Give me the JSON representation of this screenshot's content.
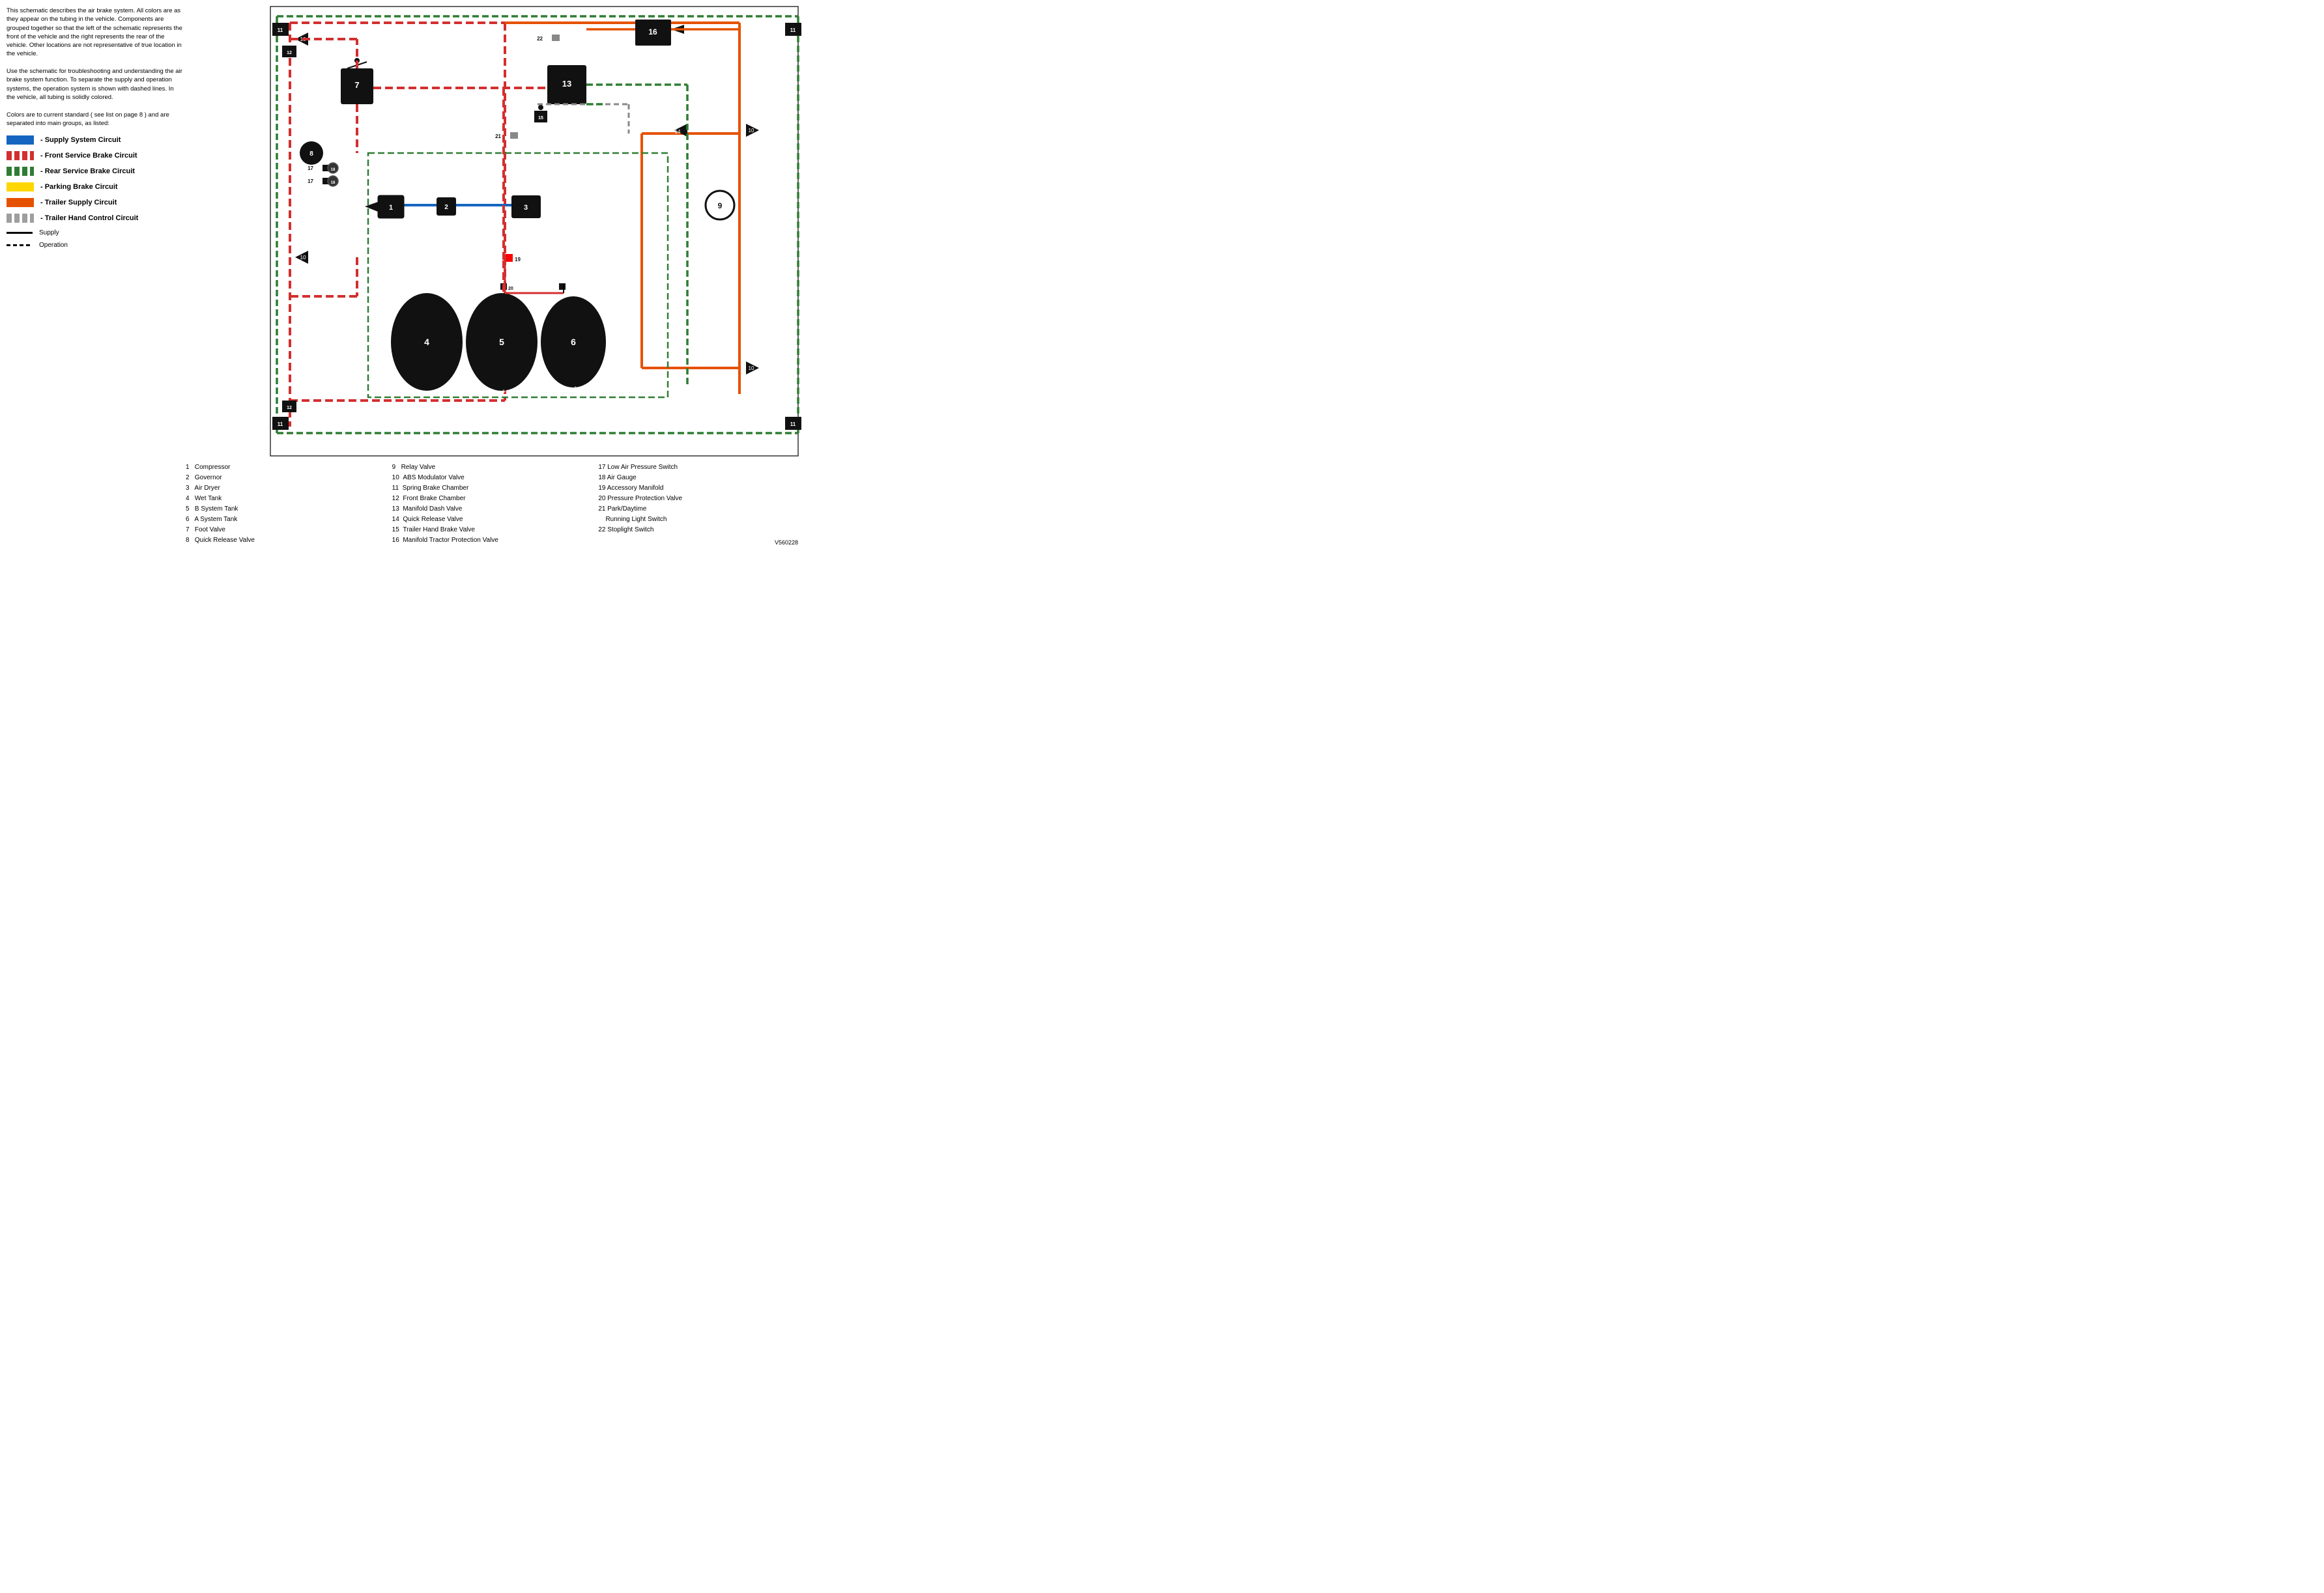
{
  "description": {
    "para1": "This schematic describes the air brake system. All colors are as they appear on the tubing in the vehicle. Components are grouped together so that the left of the schematic represents the front of the vehicle and the right represents the rear of the vehicle. Other locations are not representative of true location in the vehicle.",
    "para2": "Use the schematic for troubleshooting and understanding the air brake system function. To separate the supply and operation systems, the operation system is shown with dashed lines. In the vehicle, all tubing is solidly colored.",
    "para3": "Colors are to current standard ( see list on page 8 ) and are separated into main groups, as listed:"
  },
  "legend": [
    {
      "id": "supply-system",
      "color": "#1565C0",
      "style": "solid",
      "label": "- Supply System Circuit"
    },
    {
      "id": "front-service-brake",
      "color": "#D32F2F",
      "style": "dashed",
      "label": "- Front Service Brake Circuit"
    },
    {
      "id": "rear-service-brake",
      "color": "#2E7D32",
      "style": "dashed",
      "label": "- Rear Service Brake Circuit"
    },
    {
      "id": "parking-brake",
      "color": "#FFD600",
      "style": "solid",
      "label": "- Parking Brake Circuit"
    },
    {
      "id": "trailer-supply",
      "color": "#E65100",
      "style": "solid",
      "label": "- Trailer Supply Circuit"
    },
    {
      "id": "trailer-hand-control",
      "color": "#9E9E9E",
      "style": "dashed",
      "label": "- Trailer Hand Control Circuit"
    }
  ],
  "line_types": [
    {
      "id": "supply",
      "style": "solid",
      "label": "Supply"
    },
    {
      "id": "operation",
      "style": "dashed",
      "label": "Operation"
    }
  ],
  "parts": {
    "col1": [
      "1   Compressor",
      "2   Governor",
      "3   Air Dryer",
      "4   Wet Tank",
      "5   B System Tank",
      "6   A System Tank",
      "7   Foot Valve",
      "8   Quick Release Valve"
    ],
    "col2": [
      "9   Relay Valve",
      "10  ABS Modulator Valve",
      "11  Spring Brake Chamber",
      "12  Front Brake Chamber",
      "13  Manifold Dash Valve",
      "14  Quick Release Valve",
      "15  Trailer Hand Brake Valve",
      "16  Manifold Tractor Protection Valve"
    ],
    "col3": [
      "17 Low Air Pressure Switch",
      "18 Air Gauge",
      "19 Accessory Manifold",
      "20 Pressure Protection Valve",
      "21 Park/Daytime",
      "     Running Light Switch",
      "22 Stoplight Switch"
    ]
  },
  "version": "V560228"
}
